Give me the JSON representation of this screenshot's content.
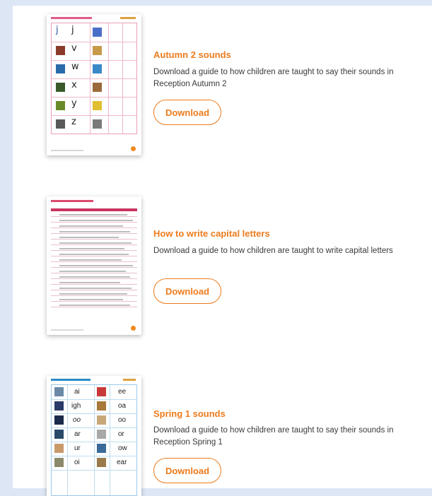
{
  "items": [
    {
      "title": "Autumn 2 sounds",
      "description": "Download a guide to how children are taught to say their sounds in Reception Autumn 2",
      "button": "Download",
      "thumbnail_letters": [
        "j",
        "j",
        "v",
        "w",
        "x",
        "y",
        "z"
      ]
    },
    {
      "title": "How to write capital letters",
      "description": "Download a guide to how children are taught to write capital letters",
      "button": "Download"
    },
    {
      "title": "Spring 1 sounds",
      "description": "Download a guide to how children are taught to say their sounds in Reception Spring 1",
      "button": "Download",
      "thumbnail_sounds": [
        "ai",
        "ee",
        "igh",
        "oa",
        "oo",
        "oo",
        "ar",
        "or",
        "ur",
        "ow",
        "oi",
        "ear"
      ]
    }
  ],
  "colors": {
    "accent": "#ec7b1c",
    "background": "#dde6f5"
  }
}
